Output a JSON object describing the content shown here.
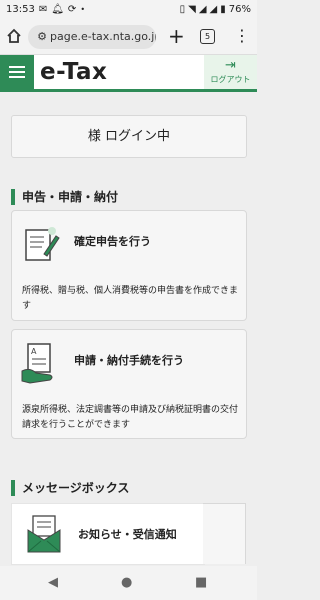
{
  "status_bar": {
    "time": "13:53",
    "battery": "76%",
    "left_icons": [
      "mail-icon",
      "bell-icon",
      "sync-icon"
    ],
    "right_icons": [
      "vibrate-icon",
      "wifi-icon",
      "signal-icon",
      "signal-icon-2",
      "battery-icon"
    ]
  },
  "browser": {
    "url": "page.e-tax.nta.go.jp",
    "tab_count": "5"
  },
  "header": {
    "logo": "e-Tax",
    "logout_label": "ログアウト"
  },
  "login_status": "様 ログイン中",
  "sections": {
    "filing": {
      "heading": "申告・申請・納付",
      "cards": [
        {
          "title": "確定申告を行う",
          "desc": "所得税、贈与税、個人消費税等の申告書を作成できます"
        },
        {
          "title": "申請・納付手続を行う",
          "desc": "源泉所得税、法定調書等の申請及び納税証明書の交付請求を行うことができます"
        }
      ]
    },
    "messages": {
      "heading": "メッセージボックス",
      "card_title": "お知らせ・受信通知"
    }
  },
  "colors": {
    "brand_green": "#2e8b57",
    "card_bg": "#f6f6f6"
  }
}
